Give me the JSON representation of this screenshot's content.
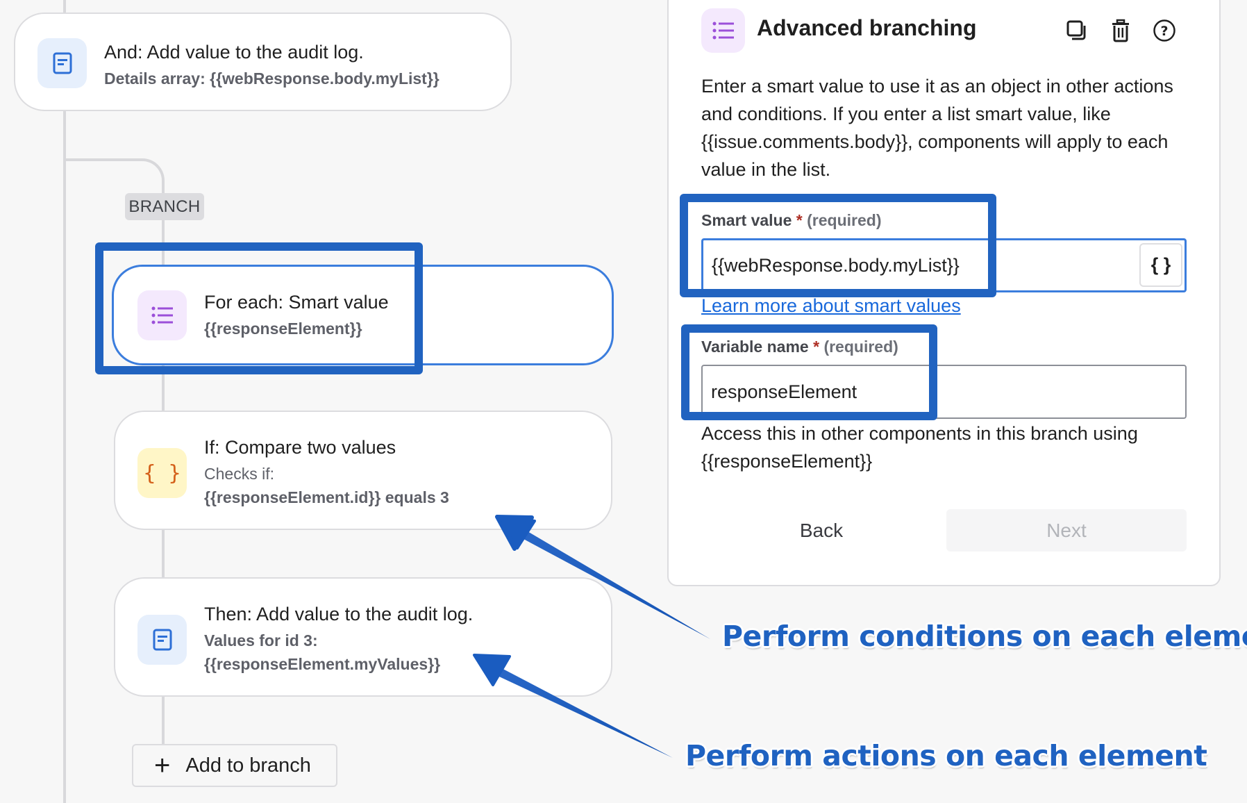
{
  "workflow": {
    "top_card": {
      "title": "And: Add value to the audit log.",
      "subtitle": "Details array: {{webResponse.body.myList}}",
      "icon": "audit-log-icon"
    },
    "branch_label": "BRANCH",
    "cards": [
      {
        "title": "For each: Smart value",
        "lines": [
          "{{responseElement}}"
        ],
        "icon": "list-icon",
        "selected": true
      },
      {
        "title": "If: Compare two values",
        "lines": [
          "Checks if:",
          "{{responseElement.id}} equals 3"
        ],
        "icon": "braces-icon",
        "selected": false
      },
      {
        "title": "Then: Add value to the audit log.",
        "lines": [
          "Values for id 3:",
          "{{responseElement.myValues}}"
        ],
        "icon": "audit-log-icon",
        "selected": false
      }
    ],
    "add_button": {
      "label": "Add to branch",
      "icon": "plus-icon"
    }
  },
  "panel": {
    "title": "Advanced branching",
    "icon": "list-icon",
    "toolbar": [
      {
        "name": "duplicate",
        "icon": "copy-icon"
      },
      {
        "name": "delete",
        "icon": "trash-icon"
      },
      {
        "name": "help",
        "icon": "help-icon"
      }
    ],
    "description": "Enter a smart value to use it as an object in other actions and conditions. If you enter a list smart value, like {{issue.comments.body}}, components will apply to each value in the list.",
    "smart_value": {
      "label": "Smart value",
      "required_mark": "*",
      "required_text": "(required)",
      "value": "{{webResponse.body.myList}}",
      "insert_button": "{ }"
    },
    "learn_more_link": "Learn more about smart values",
    "variable_name": {
      "label": "Variable name",
      "required_mark": "*",
      "required_text": "(required)",
      "value": "responseElement"
    },
    "helper_text_line1": "Access this in other components in this branch using",
    "helper_text_line2": "{{responseElement}}",
    "back_label": "Back",
    "next_label": "Next"
  },
  "annotations": {
    "conditions_text": "Perform conditions on each element",
    "actions_text": "Perform actions on each element",
    "color": "#1f62c1"
  },
  "colors": {
    "accent": "#3b7ddd",
    "annotation": "#2163c0",
    "link": "#1868db",
    "required": "#ae2e24",
    "canvas": "#f7f7f7"
  }
}
